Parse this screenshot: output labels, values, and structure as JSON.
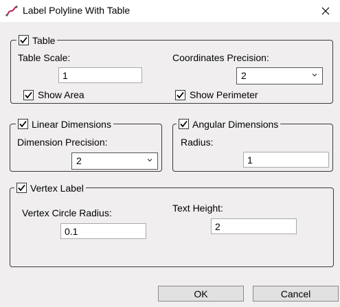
{
  "window": {
    "title": "Label Polyline With Table"
  },
  "table_group": {
    "label": "Table",
    "checked": true,
    "table_scale_label": "Table Scale:",
    "table_scale_value": "1",
    "coord_precision_label": "Coordinates Precision:",
    "coord_precision_value": "2",
    "show_area_label": "Show Area",
    "show_area_checked": true,
    "show_perimeter_label": "Show Perimeter",
    "show_perimeter_checked": true
  },
  "linear_group": {
    "label": "Linear Dimensions",
    "checked": true,
    "precision_label": "Dimension Precision:",
    "precision_value": "2"
  },
  "angular_group": {
    "label": "Angular Dimensions",
    "checked": true,
    "radius_label": "Radius:",
    "radius_value": "1"
  },
  "vertex_group": {
    "label": "Vertex Label",
    "checked": true,
    "circle_radius_label": "Vertex Circle Radius:",
    "circle_radius_value": "0.1",
    "text_height_label": "Text Height:",
    "text_height_value": "2"
  },
  "buttons": {
    "ok": "OK",
    "cancel": "Cancel"
  },
  "icons": {
    "app": "polyline-app-icon",
    "close": "close-icon",
    "check": "checkmark-icon",
    "dropdown": "chevron-down-icon"
  }
}
